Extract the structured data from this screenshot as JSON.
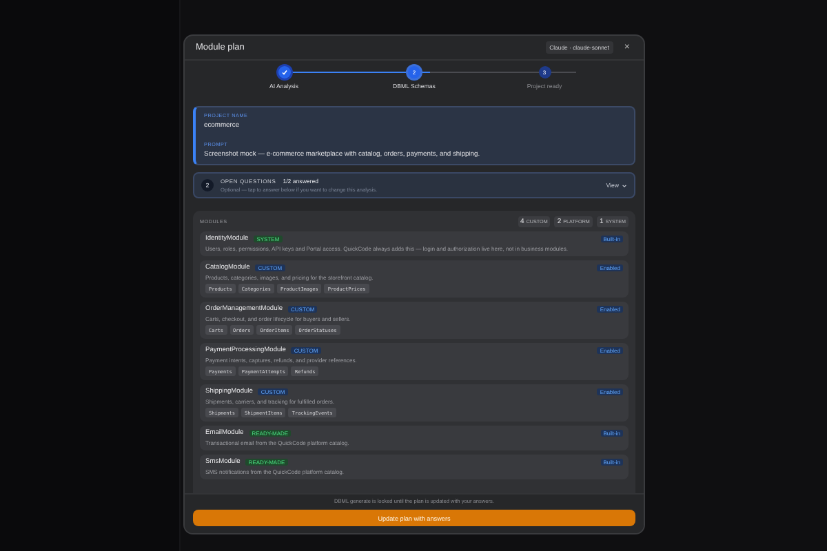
{
  "dialog": {
    "title": "Module plan",
    "model_badge": "Claude · claude-sonnet",
    "close": "×"
  },
  "steps": [
    {
      "label": "AI Analysis",
      "done": true,
      "current": false
    },
    {
      "number": "2",
      "label": "DBML Schemas",
      "done": false,
      "current": true
    },
    {
      "number": "3",
      "label": "Project ready",
      "done": false,
      "current": false
    }
  ],
  "project": {
    "name_label": "PROJECT NAME",
    "name": "ecommerce",
    "prompt_label": "PROMPT",
    "prompt": "Screenshot mock — e-commerce marketplace with catalog, orders, payments, and shipping."
  },
  "questions": {
    "count": "2",
    "title": "OPEN QUESTIONS",
    "answered": "1/2 answered",
    "hint": "Optional — tap to answer below if you want to change this analysis.",
    "toggle": "View",
    "expanded": false
  },
  "modules_panel": {
    "title": "MODULES",
    "counts": [
      {
        "number": "4",
        "label": "CUSTOM"
      },
      {
        "number": "2",
        "label": "PLATFORM"
      },
      {
        "number": "1",
        "label": "SYSTEM"
      }
    ]
  },
  "modules": [
    {
      "name": "IdentityModule",
      "tag": "SYSTEM",
      "kind": "system",
      "status": "Built-in",
      "description": "Users, roles, permissions, API keys and Portal access. QuickCode always adds this — login and authorization live here, not in business modules."
    },
    {
      "name": "CatalogModule",
      "tag": "CUSTOM",
      "kind": "custom",
      "status": "Enabled",
      "description": "Products, categories, images, and pricing for the storefront catalog.",
      "entities": [
        "Products",
        "Categories",
        "ProductImages",
        "ProductPrices"
      ]
    },
    {
      "name": "OrderManagementModule",
      "tag": "CUSTOM",
      "kind": "custom",
      "status": "Enabled",
      "description": "Carts, checkout, and order lifecycle for buyers and sellers.",
      "entities": [
        "Carts",
        "Orders",
        "OrderItems",
        "OrderStatuses"
      ]
    },
    {
      "name": "PaymentProcessingModule",
      "tag": "CUSTOM",
      "kind": "custom",
      "status": "Enabled",
      "description": "Payment intents, captures, refunds, and provider references.",
      "entities": [
        "Payments",
        "PaymentAttempts",
        "Refunds"
      ]
    },
    {
      "name": "ShippingModule",
      "tag": "CUSTOM",
      "kind": "custom",
      "status": "Enabled",
      "description": "Shipments, carriers, and tracking for fulfilled orders.",
      "entities": [
        "Shipments",
        "ShipmentItems",
        "TrackingEvents"
      ]
    },
    {
      "name": "EmailModule",
      "tag": "READY-MADE",
      "kind": "platform",
      "status": "Built-in",
      "description": "Transactional email from the QuickCode platform catalog."
    },
    {
      "name": "SmsModule",
      "tag": "READY-MADE",
      "kind": "platform",
      "status": "Built-in",
      "description": "SMS notifications from the QuickCode platform catalog."
    }
  ],
  "footer": {
    "note": "DBML generate is locked until the plan is updated with your answers.",
    "button": "Update plan with answers"
  }
}
